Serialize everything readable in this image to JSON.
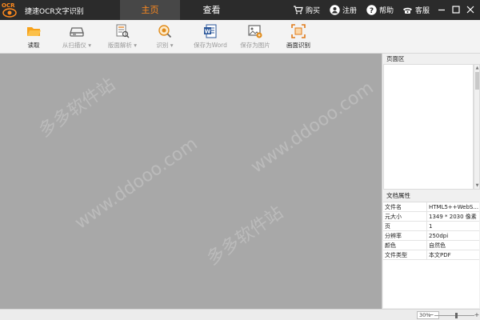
{
  "app": {
    "logo_text": "OCR",
    "title": "捷速OCR文字识别",
    "accent": "#ff8a1e"
  },
  "main_tabs": [
    {
      "label": "主页",
      "active": true
    },
    {
      "label": "查看",
      "active": false
    }
  ],
  "titlebar_actions": [
    {
      "label": "购买",
      "icon": "cart-icon"
    },
    {
      "label": "注册",
      "icon": "user-icon"
    },
    {
      "label": "帮助",
      "icon": "help-icon"
    },
    {
      "label": "客服",
      "icon": "phone-icon"
    }
  ],
  "window_controls": [
    "minimize-icon",
    "maximize-icon",
    "close-icon"
  ],
  "ribbon": [
    {
      "label": "读取",
      "icon": "folder-open-icon",
      "enabled": true
    },
    {
      "label": "从扫描仪 ▾",
      "icon": "scanner-icon",
      "enabled": false
    },
    {
      "label": "版面解析 ▾",
      "icon": "layout-analysis-icon",
      "enabled": false
    },
    {
      "label": "识别 ▾",
      "icon": "recognize-icon",
      "enabled": false
    },
    {
      "label": "保存为Word",
      "icon": "word-icon",
      "enabled": false
    },
    {
      "label": "保存为图片",
      "icon": "save-image-icon",
      "enabled": false
    },
    {
      "label": "画面识别",
      "icon": "screen-capture-icon",
      "enabled": true
    }
  ],
  "right_panel": {
    "pages_header": "页面区",
    "props_header": "文档属性",
    "properties": [
      {
        "key": "文件名",
        "value": "HTML5++WebS..."
      },
      {
        "key": "元大小",
        "value": "1349 * 2030 像素"
      },
      {
        "key": "页",
        "value": "1"
      },
      {
        "key": "分辨率",
        "value": "250dpi"
      },
      {
        "key": "颜色",
        "value": "自然色"
      },
      {
        "key": "文件类型",
        "value": "本文PDF"
      }
    ]
  },
  "watermark": {
    "text": "www.ddooo.com",
    "text_cn": "多多软件站"
  },
  "statusbar": {
    "zoom": "30%",
    "zoom_level": 0.55
  }
}
